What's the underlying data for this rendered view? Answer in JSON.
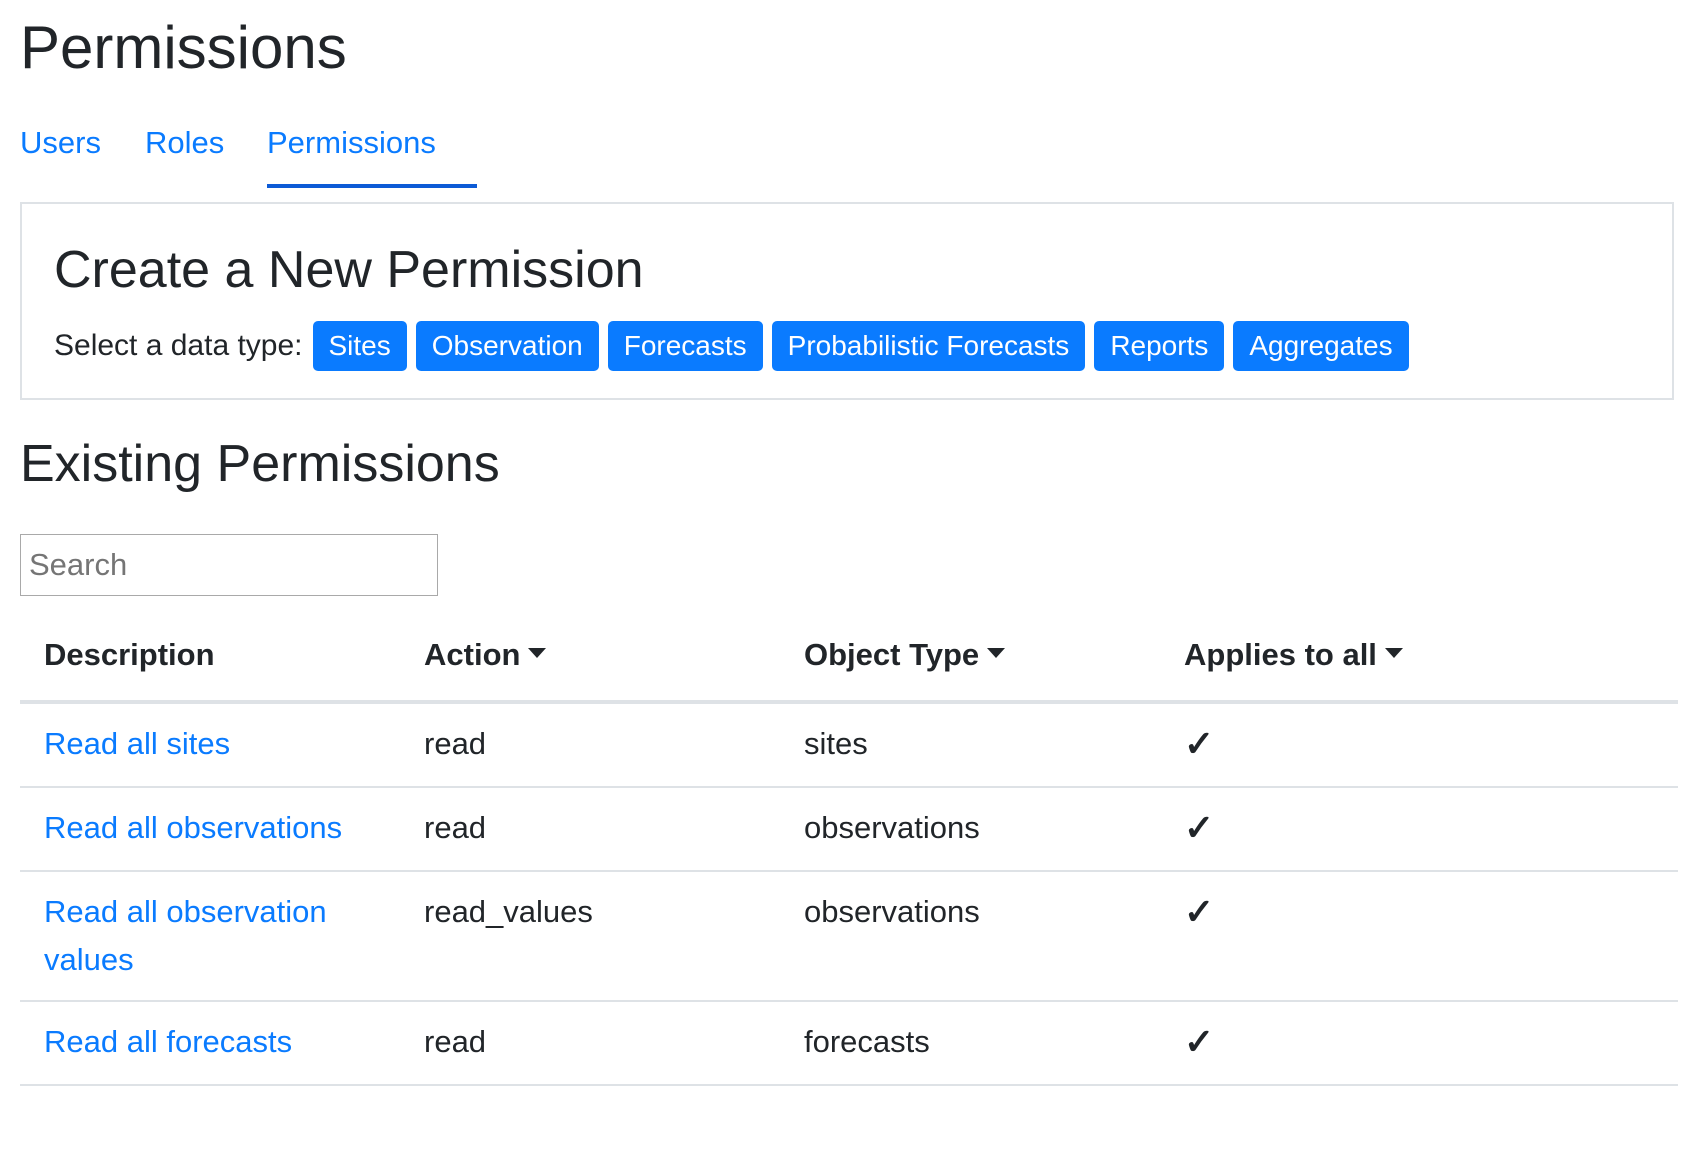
{
  "page_title": "Permissions",
  "tabs": [
    {
      "label": "Users",
      "active": false
    },
    {
      "label": "Roles",
      "active": false
    },
    {
      "label": "Permissions",
      "active": true
    }
  ],
  "create": {
    "title": "Create a New Permission",
    "select_label": "Select a data type:",
    "data_types": [
      "Sites",
      "Observation",
      "Forecasts",
      "Probabilistic Forecasts",
      "Reports",
      "Aggregates"
    ]
  },
  "existing": {
    "title": "Existing Permissions",
    "search_placeholder": "Search",
    "search_value": ""
  },
  "table": {
    "columns": [
      {
        "label": "Description",
        "has_caret": false
      },
      {
        "label": "Action",
        "has_caret": true
      },
      {
        "label": "Object Type",
        "has_caret": true
      },
      {
        "label": "Applies to all",
        "has_caret": true
      }
    ],
    "rows": [
      {
        "description": "Read all sites",
        "action": "read",
        "object_type": "sites",
        "applies_to_all": "✓"
      },
      {
        "description": "Read all observations",
        "action": "read",
        "object_type": "observations",
        "applies_to_all": "✓"
      },
      {
        "description": "Read all observation values",
        "action": "read_values",
        "object_type": "observations",
        "applies_to_all": "✓"
      },
      {
        "description": "Read all forecasts",
        "action": "read",
        "object_type": "forecasts",
        "applies_to_all": "✓"
      }
    ]
  },
  "colors": {
    "link": "#0a7bff",
    "button_bg": "#0a7bff",
    "active_tab_underline": "#0d5bd6",
    "border": "#dee2e6",
    "text": "#212529"
  }
}
